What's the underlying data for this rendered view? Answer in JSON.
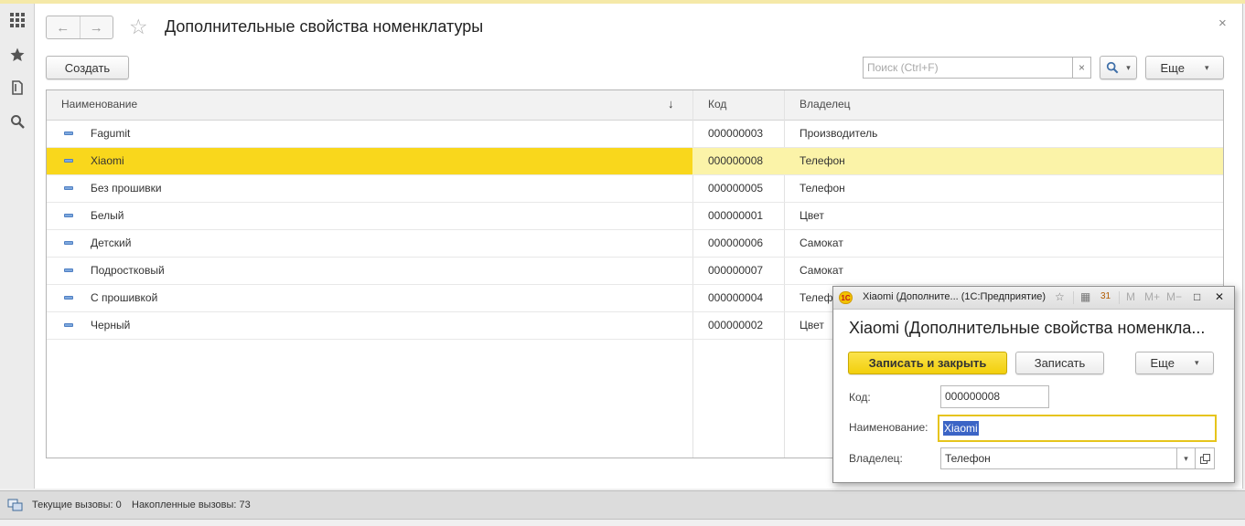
{
  "page": {
    "title": "Дополнительные свойства номенклатуры",
    "create_label": "Создать",
    "search_placeholder": "Поиск (Ctrl+F)",
    "search_clear": "×",
    "more_label": "Еще",
    "close_glyph": "×"
  },
  "icons": {
    "grid": "grid-menu-icon",
    "star": "favorites-star-icon",
    "history": "history-icon",
    "search": "search-icon",
    "back": "←",
    "forward": "→",
    "dropdown": "▾",
    "sort": "↓"
  },
  "table": {
    "columns": [
      "Наименование",
      "Код",
      "Владелец"
    ],
    "rows": [
      {
        "name": "Fagumit",
        "code": "000000003",
        "owner": "Производитель"
      },
      {
        "name": "Xiaomi",
        "code": "000000008",
        "owner": "Телефон",
        "selected": true
      },
      {
        "name": "Без прошивки",
        "code": "000000005",
        "owner": "Телефон"
      },
      {
        "name": "Белый",
        "code": "000000001",
        "owner": "Цвет"
      },
      {
        "name": "Детский",
        "code": "000000006",
        "owner": "Самокат"
      },
      {
        "name": "Подростковый",
        "code": "000000007",
        "owner": "Самокат"
      },
      {
        "name": "С прошивкой",
        "code": "000000004",
        "owner": "Телефон"
      },
      {
        "name": "Черный",
        "code": "000000002",
        "owner": "Цвет"
      }
    ]
  },
  "status": {
    "current_calls": "Текущие вызовы: 0",
    "accumulated_calls": "Накопленные вызовы: 73"
  },
  "modal": {
    "window_title": "Xiaomi (Дополните... (1С:Предприятие)",
    "heading": "Xiaomi (Дополнительные свойства номенкла...",
    "save_close_label": "Записать и закрыть",
    "save_label": "Записать",
    "more_label": "Еще",
    "code_label": "Код:",
    "code_value": "000000008",
    "name_label": "Наименование:",
    "name_value": "Xiaomi",
    "owner_label": "Владелец:",
    "owner_value": "Телефон",
    "logo_text": "1С",
    "tb_favorite": "☆",
    "tb_calc": "▦",
    "tb_calendar": "31",
    "tb_m": "M",
    "tb_mplus": "M+",
    "tb_mminus": "M−",
    "tb_maximize": "□",
    "tb_close": "✕"
  },
  "colors": {
    "accent_yellow": "#f9d71c",
    "selected_row": "#fbf3a8",
    "selection_highlight": "#3b64c6"
  }
}
